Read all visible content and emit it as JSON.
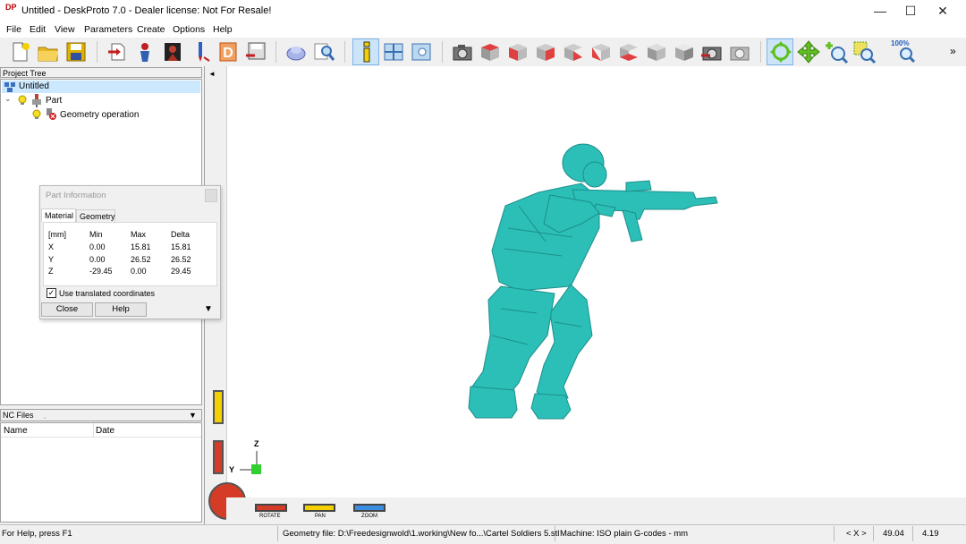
{
  "window": {
    "icon_text": "DP",
    "title": "Untitled - DeskProto 7.0 - Dealer license: Not For Resale!",
    "minimize": "—",
    "maximize": "☐",
    "close": "✕"
  },
  "menu": [
    "File",
    "Edit",
    "View",
    "Parameters",
    "Create",
    "Options",
    "Help"
  ],
  "toolbar": {
    "zoom_label": "100%",
    "overflow": "»"
  },
  "project_tree": {
    "header": "Project Tree",
    "root": "Untitled",
    "part": "Part",
    "operation": "Geometry operation"
  },
  "part_info": {
    "title": "Part Information",
    "tabs": [
      "Material",
      "Geometry"
    ],
    "headers": [
      "[mm]",
      "Min",
      "Max",
      "Delta"
    ],
    "rows": [
      [
        "X",
        "0.00",
        "15.81",
        "15.81"
      ],
      [
        "Y",
        "0.00",
        "26.52",
        "26.52"
      ],
      [
        "Z",
        "-29.45",
        "0.00",
        "29.45"
      ]
    ],
    "checkbox_label": "Use translated coordinates",
    "checkbox_checked": true,
    "close_btn": "Close",
    "help_btn": "Help"
  },
  "nc_files": {
    "header": "NC Files",
    "columns": [
      "Name",
      "Date"
    ]
  },
  "viewport": {
    "axis_z": "Z",
    "axis_y": "Y",
    "model_color": "#2bbfb8",
    "controls": [
      "ROTATE",
      "PAN",
      "ZOOM"
    ]
  },
  "status": {
    "help": "For Help, press F1",
    "geometry": "Geometry file: D:\\Freedesignwold\\1.working\\New fo...\\Cartel Soldiers 5.stl",
    "machine": "Machine: ISO plain G-codes - mm",
    "axis": "< X >",
    "val1": "49.04",
    "val2": "4.19"
  }
}
